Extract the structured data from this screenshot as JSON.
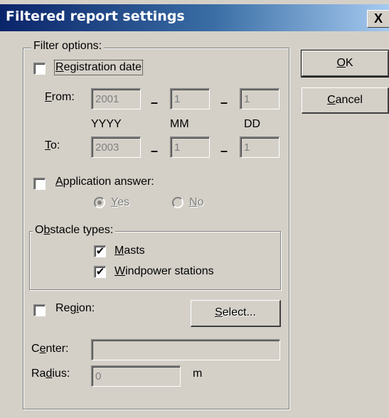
{
  "window": {
    "title": "Filtered report settings",
    "close_glyph": "X"
  },
  "filter_group": {
    "legend": "Filter options:"
  },
  "registration_date": {
    "checked": false,
    "label_pre": "",
    "label_accel": "R",
    "label_post": "egistration date",
    "from_accel": "F",
    "from_post": "rom:",
    "from_year": "2001",
    "from_month": "1",
    "from_day": "1",
    "yyyy": "YYYY",
    "mm": "MM",
    "dd": "DD",
    "to_accel": "T",
    "to_post": "o:",
    "to_year": "2003",
    "to_month": "1",
    "to_day": "1",
    "separator": "–"
  },
  "application_answer": {
    "checked": false,
    "label_accel": "A",
    "label_post": "pplication answer:",
    "yes_accel": "Y",
    "yes_post": "es",
    "yes_selected": true,
    "no_accel": "N",
    "no_post": "o",
    "no_selected": false
  },
  "obstacle_types": {
    "legend_pre": "O",
    "legend_accel": "b",
    "legend_post": "stacle types:",
    "masts_accel": "M",
    "masts_post": "asts",
    "masts_checked": true,
    "wind_accel": "W",
    "wind_post": "indpower stations",
    "wind_checked": true,
    "check_glyph": "✔"
  },
  "region": {
    "checked": false,
    "label_pre": "Reg",
    "label_accel": "i",
    "label_post": "on:",
    "select_accel": "S",
    "select_post": "elect...",
    "center_pre": "C",
    "center_accel": "e",
    "center_post": "nter:",
    "center_value": "",
    "radius_pre": "Ra",
    "radius_accel": "d",
    "radius_post": "ius:",
    "radius_value": "0",
    "radius_unit": "m"
  },
  "buttons": {
    "ok_accel": "O",
    "ok_post": "K",
    "cancel_accel": "C",
    "cancel_post": "ancel"
  },
  "colors": {
    "titlebar_start": "#0a246a",
    "titlebar_end": "#a6caf0",
    "face": "#d4d0c8",
    "disabled_text": "#808080"
  }
}
